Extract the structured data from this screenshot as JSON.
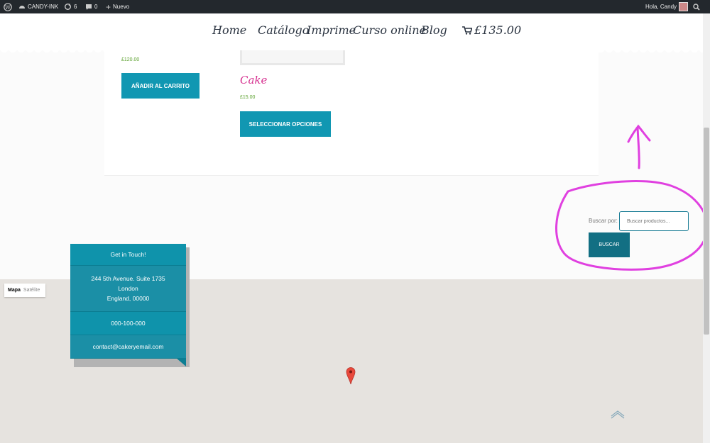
{
  "adminbar": {
    "site_name": "CANDY-INK",
    "updates_count": "6",
    "comments_count": "0",
    "new_label": "Nuevo",
    "greeting": "Hola, Candy"
  },
  "nav": {
    "items": [
      "Home",
      "Catálogo",
      "Imprime",
      "Curso online",
      "Blog"
    ],
    "cart_total": "£135.00"
  },
  "products": {
    "first": {
      "price": "£120.00",
      "button": "AÑADIR AL CARRITO"
    },
    "second": {
      "title": "Cake",
      "price": "£15.00",
      "button": "SELECCIONAR OPCIONES"
    }
  },
  "search": {
    "label": "Buscar por:",
    "placeholder": "Buscar productos...",
    "button": "BUSCAR"
  },
  "map": {
    "type_active": "Mapa",
    "type_inactive": "Satélite"
  },
  "contact": {
    "heading": "Get in Touch!",
    "address_line1": "244 5th Avenue. Suite 1735",
    "address_line2": "London",
    "address_line3": "England, 00000",
    "phone": "000-100-000",
    "email": "contact@cakeryemail.com"
  },
  "colors": {
    "accent": "#1197b2",
    "annotation": "#e040e0",
    "price": "#5aa02c",
    "title": "#d6308f"
  }
}
